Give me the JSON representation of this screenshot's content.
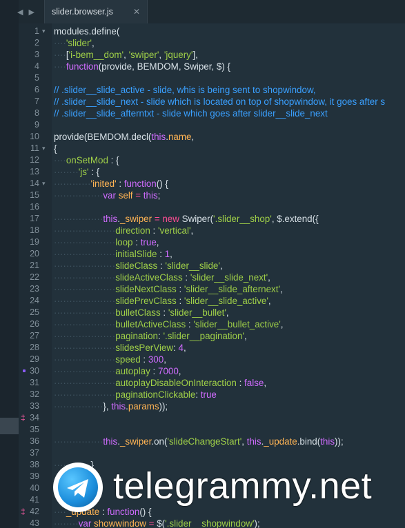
{
  "tab": {
    "filename": "slider.browser.js",
    "close_glyph": "✕",
    "back_icon": "◀",
    "forward_icon": "▶"
  },
  "colors": {
    "comment": "#3aa0ff",
    "string": "#9fcf48",
    "keyword": "#d06cff",
    "operator": "#ff4d94",
    "background": "#22313b"
  },
  "lines": [
    {
      "n": "1",
      "fold": "▾",
      "tokens": [
        [
          "modules.define(",
          "c-ident"
        ]
      ]
    },
    {
      "n": "2",
      "tokens": [
        [
          "····",
          "ws"
        ],
        [
          "'slider'",
          "c-str"
        ],
        [
          ",",
          "c-ident"
        ]
      ]
    },
    {
      "n": "3",
      "tokens": [
        [
          "····",
          "ws"
        ],
        [
          "[",
          "c-ident"
        ],
        [
          "'i-bem__dom'",
          "c-str"
        ],
        [
          ", ",
          "c-ident"
        ],
        [
          "'swiper'",
          "c-str"
        ],
        [
          ", ",
          "c-ident"
        ],
        [
          "'jquery'",
          "c-str"
        ],
        [
          "],",
          "c-ident"
        ]
      ]
    },
    {
      "n": "4",
      "tokens": [
        [
          "····",
          "ws"
        ],
        [
          "function",
          "c-kw"
        ],
        [
          "(provide, BEMDOM, Swiper, $) {",
          "c-ident"
        ]
      ]
    },
    {
      "n": "5",
      "tokens": []
    },
    {
      "n": "6",
      "tokens": [
        [
          "// .slider__slide_active - slide, whis is being sent to shopwindow,",
          "c-com"
        ]
      ]
    },
    {
      "n": "7",
      "tokens": [
        [
          "// .slider__slide_next - slide which is located on top of shopwindow, it goes after s",
          "c-com"
        ]
      ]
    },
    {
      "n": "8",
      "tokens": [
        [
          "// .slider__slide_afterntxt - slide which goes after slider__slide_next",
          "c-com"
        ]
      ]
    },
    {
      "n": "9",
      "tokens": []
    },
    {
      "n": "10",
      "tokens": [
        [
          "provide(BEMDOM.decl(",
          "c-ident"
        ],
        [
          "this",
          "c-kw"
        ],
        [
          ".",
          "c-ident"
        ],
        [
          "name",
          "c-func"
        ],
        [
          ",",
          "c-ident"
        ]
      ]
    },
    {
      "n": "11",
      "fold": "▾",
      "tokens": [
        [
          "{",
          "c-ident"
        ]
      ]
    },
    {
      "n": "12",
      "tokens": [
        [
          "····",
          "ws"
        ],
        [
          "onSetMod",
          "c-prop"
        ],
        [
          " : {",
          "c-ident"
        ]
      ]
    },
    {
      "n": "13",
      "tokens": [
        [
          "········",
          "ws"
        ],
        [
          "'js'",
          "c-str"
        ],
        [
          " : {",
          "c-ident"
        ]
      ]
    },
    {
      "n": "14",
      "fold": "▾",
      "tokens": [
        [
          "············",
          "ws"
        ],
        [
          "'inited'",
          "c-func"
        ],
        [
          " : ",
          "c-ident"
        ],
        [
          "function",
          "c-kw"
        ],
        [
          "() {",
          "c-ident"
        ]
      ]
    },
    {
      "n": "15",
      "tokens": [
        [
          "················",
          "ws"
        ],
        [
          "var ",
          "c-kw"
        ],
        [
          "self",
          "c-func"
        ],
        [
          " = ",
          "c-pink"
        ],
        [
          "this",
          "c-kw"
        ],
        [
          ";",
          "c-ident"
        ]
      ]
    },
    {
      "n": "16",
      "tokens": []
    },
    {
      "n": "17",
      "tokens": [
        [
          "················",
          "ws"
        ],
        [
          "this",
          "c-kw"
        ],
        [
          ".",
          "c-ident"
        ],
        [
          "_swiper",
          "c-func"
        ],
        [
          " = ",
          "c-pink"
        ],
        [
          "new ",
          "c-pink"
        ],
        [
          "Swiper(",
          "c-ident"
        ],
        [
          "'.slider__shop'",
          "c-str"
        ],
        [
          ", $.extend({",
          "c-ident"
        ]
      ]
    },
    {
      "n": "18",
      "tokens": [
        [
          "····················",
          "ws"
        ],
        [
          "direction",
          "c-prop"
        ],
        [
          " : ",
          "c-ident"
        ],
        [
          "'vertical'",
          "c-str"
        ],
        [
          ",",
          "c-ident"
        ]
      ]
    },
    {
      "n": "19",
      "tokens": [
        [
          "····················",
          "ws"
        ],
        [
          "loop",
          "c-prop"
        ],
        [
          " : ",
          "c-ident"
        ],
        [
          "true",
          "c-kw"
        ],
        [
          ",",
          "c-ident"
        ]
      ]
    },
    {
      "n": "20",
      "tokens": [
        [
          "····················",
          "ws"
        ],
        [
          "initialSlide",
          "c-prop"
        ],
        [
          " : ",
          "c-ident"
        ],
        [
          "1",
          "c-kw"
        ],
        [
          ",",
          "c-ident"
        ]
      ]
    },
    {
      "n": "21",
      "tokens": [
        [
          "····················",
          "ws"
        ],
        [
          "slideClass",
          "c-prop"
        ],
        [
          " : ",
          "c-ident"
        ],
        [
          "'slider__slide'",
          "c-str"
        ],
        [
          ",",
          "c-ident"
        ]
      ]
    },
    {
      "n": "22",
      "tokens": [
        [
          "····················",
          "ws"
        ],
        [
          "slideActiveClass",
          "c-prop"
        ],
        [
          " : ",
          "c-ident"
        ],
        [
          "'slider__slide_next'",
          "c-str"
        ],
        [
          ",",
          "c-ident"
        ]
      ]
    },
    {
      "n": "23",
      "tokens": [
        [
          "····················",
          "ws"
        ],
        [
          "slideNextClass",
          "c-prop"
        ],
        [
          " : ",
          "c-ident"
        ],
        [
          "'slider__slide_afternext'",
          "c-str"
        ],
        [
          ",",
          "c-ident"
        ]
      ]
    },
    {
      "n": "24",
      "tokens": [
        [
          "····················",
          "ws"
        ],
        [
          "slidePrevClass",
          "c-prop"
        ],
        [
          " : ",
          "c-ident"
        ],
        [
          "'slider__slide_active'",
          "c-str"
        ],
        [
          ",",
          "c-ident"
        ]
      ]
    },
    {
      "n": "25",
      "tokens": [
        [
          "····················",
          "ws"
        ],
        [
          "bulletClass",
          "c-prop"
        ],
        [
          " : ",
          "c-ident"
        ],
        [
          "'slider__bullet'",
          "c-str"
        ],
        [
          ",",
          "c-ident"
        ]
      ]
    },
    {
      "n": "26",
      "tokens": [
        [
          "····················",
          "ws"
        ],
        [
          "bulletActiveClass",
          "c-prop"
        ],
        [
          " : ",
          "c-ident"
        ],
        [
          "'slider__bullet_active'",
          "c-str"
        ],
        [
          ",",
          "c-ident"
        ]
      ]
    },
    {
      "n": "27",
      "tokens": [
        [
          "····················",
          "ws"
        ],
        [
          "pagination",
          "c-prop"
        ],
        [
          ": ",
          "c-ident"
        ],
        [
          "'.slider__pagination'",
          "c-str"
        ],
        [
          ",",
          "c-ident"
        ]
      ]
    },
    {
      "n": "28",
      "tokens": [
        [
          "····················",
          "ws"
        ],
        [
          "slidesPerView",
          "c-prop"
        ],
        [
          ": ",
          "c-ident"
        ],
        [
          "4",
          "c-kw"
        ],
        [
          ",",
          "c-ident"
        ]
      ]
    },
    {
      "n": "29",
      "tokens": [
        [
          "····················",
          "ws"
        ],
        [
          "speed",
          "c-prop"
        ],
        [
          " : ",
          "c-ident"
        ],
        [
          "300",
          "c-kw"
        ],
        [
          ",",
          "c-ident"
        ]
      ]
    },
    {
      "n": "30",
      "mark": "square",
      "tokens": [
        [
          "····················",
          "ws"
        ],
        [
          "autoplay",
          "c-prop"
        ],
        [
          " : ",
          "c-ident"
        ],
        [
          "7000",
          "c-kw"
        ],
        [
          ",",
          "c-ident"
        ]
      ]
    },
    {
      "n": "31",
      "tokens": [
        [
          "····················",
          "ws"
        ],
        [
          "autoplayDisableOnInteraction",
          "c-prop"
        ],
        [
          " : ",
          "c-ident"
        ],
        [
          "false",
          "c-kw"
        ],
        [
          ",",
          "c-ident"
        ]
      ]
    },
    {
      "n": "32",
      "tokens": [
        [
          "····················",
          "ws"
        ],
        [
          "paginationClickable",
          "c-prop"
        ],
        [
          ": ",
          "c-ident"
        ],
        [
          "true",
          "c-kw"
        ]
      ]
    },
    {
      "n": "33",
      "tokens": [
        [
          "················",
          "ws"
        ],
        [
          "}, ",
          "c-ident"
        ],
        [
          "this",
          "c-kw"
        ],
        [
          ".",
          "c-ident"
        ],
        [
          "params",
          "c-func"
        ],
        [
          "));",
          "c-ident"
        ]
      ]
    },
    {
      "n": "34",
      "mark": "diff",
      "tokens": []
    },
    {
      "n": "35",
      "tokens": []
    },
    {
      "n": "36",
      "tokens": [
        [
          "················",
          "ws"
        ],
        [
          "this",
          "c-kw"
        ],
        [
          ".",
          "c-ident"
        ],
        [
          "_swiper",
          "c-func"
        ],
        [
          ".on(",
          "c-ident"
        ],
        [
          "'slideChangeStart'",
          "c-str"
        ],
        [
          ", ",
          "c-ident"
        ],
        [
          "this",
          "c-kw"
        ],
        [
          ".",
          "c-ident"
        ],
        [
          "_update",
          "c-func"
        ],
        [
          ".bind(",
          "c-ident"
        ],
        [
          "this",
          "c-kw"
        ],
        [
          "));",
          "c-ident"
        ]
      ]
    },
    {
      "n": "37",
      "tokens": []
    },
    {
      "n": "38",
      "tokens": [
        [
          "············",
          "ws"
        ],
        [
          "}",
          "c-ident"
        ]
      ]
    },
    {
      "n": "39",
      "tokens": []
    },
    {
      "n": "40",
      "tokens": []
    },
    {
      "n": "41",
      "tokens": []
    },
    {
      "n": "42",
      "mark": "diff",
      "tokens": [
        [
          "····",
          "ws"
        ],
        [
          "_update",
          "c-func"
        ],
        [
          " : ",
          "c-ident"
        ],
        [
          "function",
          "c-kw"
        ],
        [
          "() {",
          "c-ident"
        ]
      ]
    },
    {
      "n": "43",
      "tokens": [
        [
          "········",
          "ws"
        ],
        [
          "var ",
          "c-kw"
        ],
        [
          "showwindow",
          "c-func"
        ],
        [
          " = ",
          "c-pink"
        ],
        [
          "$(",
          "c-ident"
        ],
        [
          "'.slider__shopwindow'",
          "c-str"
        ],
        [
          ");",
          "c-ident"
        ]
      ]
    }
  ],
  "watermark": {
    "text": "telegrammy.net",
    "logo_icon": "telegram-plane-icon"
  }
}
